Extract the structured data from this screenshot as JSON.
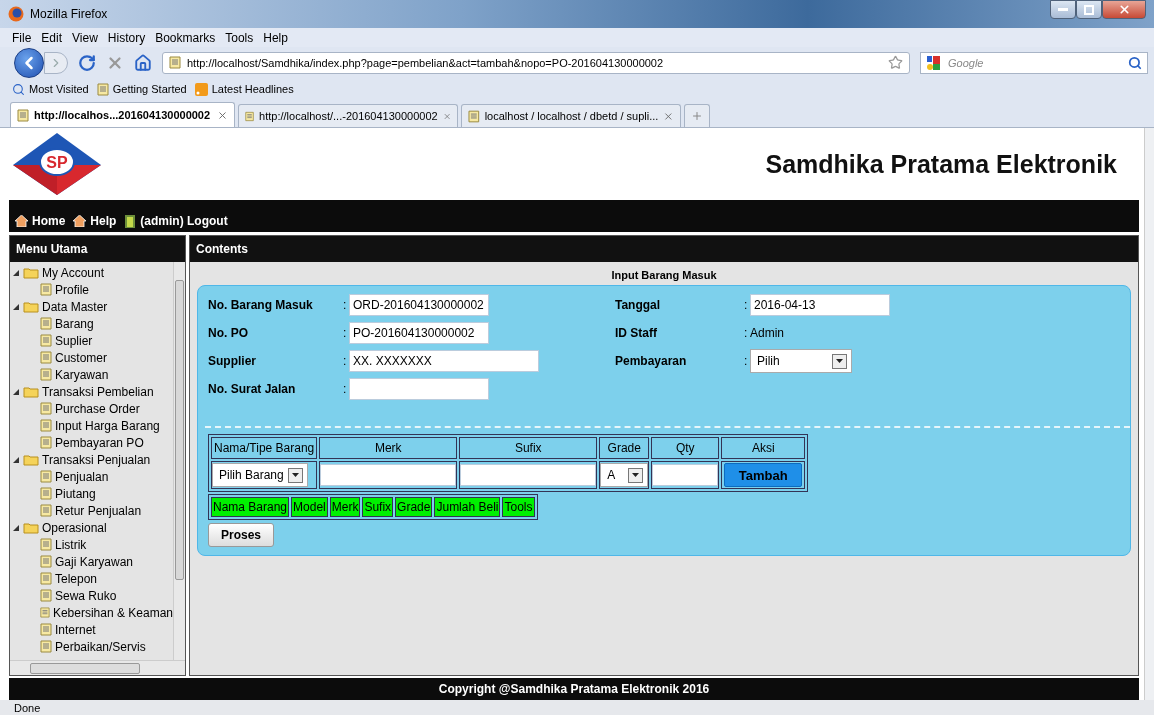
{
  "window": {
    "title": "Mozilla Firefox"
  },
  "menu": [
    "File",
    "Edit",
    "View",
    "History",
    "Bookmarks",
    "Tools",
    "Help"
  ],
  "address": {
    "value": "http://localhost/Samdhika/index.php?page=pembelian&act=tambah&nopo=PO-201604130000002"
  },
  "search": {
    "placeholder": "Google"
  },
  "bookmarks": [
    "Most Visited",
    "Getting Started",
    "Latest Headlines"
  ],
  "tabs": [
    {
      "label": "http://localhos...201604130000002",
      "selected": true
    },
    {
      "label": "http://localhost/...-201604130000002",
      "selected": false
    },
    {
      "label": "localhost / localhost / dbetd / supli...",
      "selected": false
    }
  ],
  "site": {
    "logo": "SP",
    "title": "Samdhika Pratama Elektronik",
    "nav": [
      "Home",
      "Help",
      "(admin) Logout"
    ]
  },
  "sidebar": {
    "title": "Menu Utama",
    "tree": [
      {
        "label": "My Account",
        "expanded": true,
        "children": [
          "Profile"
        ]
      },
      {
        "label": "Data Master",
        "expanded": true,
        "children": [
          "Barang",
          "Suplier",
          "Customer",
          "Karyawan"
        ]
      },
      {
        "label": "Transaksi Pembelian",
        "expanded": true,
        "children": [
          "Purchase Order",
          "Input Harga Barang",
          "Pembayaran PO"
        ]
      },
      {
        "label": "Transaksi Penjualan",
        "expanded": true,
        "children": [
          "Penjualan",
          "Piutang",
          "Retur Penjualan"
        ]
      },
      {
        "label": "Operasional",
        "expanded": true,
        "children": [
          "Listrik",
          "Gaji Karyawan",
          "Telepon",
          "Sewa Ruko",
          "Kebersihan & Keaman",
          "Internet",
          "Perbaikan/Servis"
        ]
      }
    ]
  },
  "content": {
    "title": "Contents",
    "form_title": "Input Barang Masuk",
    "left_fields": [
      {
        "label": "No. Barang Masuk",
        "separator": ":",
        "kind": "input",
        "value": "ORD-201604130000002",
        "wide": false
      },
      {
        "label": "No. PO",
        "separator": ":",
        "kind": "input",
        "value": "PO-201604130000002",
        "wide": false
      },
      {
        "label": "Supplier",
        "separator": ":",
        "kind": "input",
        "value": "XX. XXXXXXX",
        "wide": true
      },
      {
        "label": "No. Surat Jalan",
        "separator": ":",
        "kind": "input",
        "wide": false
      }
    ],
    "right_fields": [
      {
        "label": "Tanggal",
        "separator": ":",
        "kind": "input",
        "value": "2016-04-13"
      },
      {
        "label": "ID Staff",
        "separator": ":",
        "kind": "text",
        "value": "Admin"
      },
      {
        "label": "Pembayaran",
        "separator": ":",
        "kind": "select",
        "value": "Pilih"
      }
    ],
    "item_table": {
      "columns": [
        "Nama/Tipe Barang",
        "Merk",
        "Sufix",
        "Grade",
        "Qty",
        "Aksi"
      ],
      "row": {
        "barang": "Pilih Barang",
        "grade": "A",
        "action": "Tambah"
      }
    },
    "list_columns": [
      "Nama Barang",
      "Model",
      "Merk",
      "Sufix",
      "Grade",
      "Jumlah Beli",
      "Tools"
    ],
    "submit": "Proses"
  },
  "footer": "Copyright @Samdhika Pratama Elektronik 2016",
  "status_bar": "Done"
}
